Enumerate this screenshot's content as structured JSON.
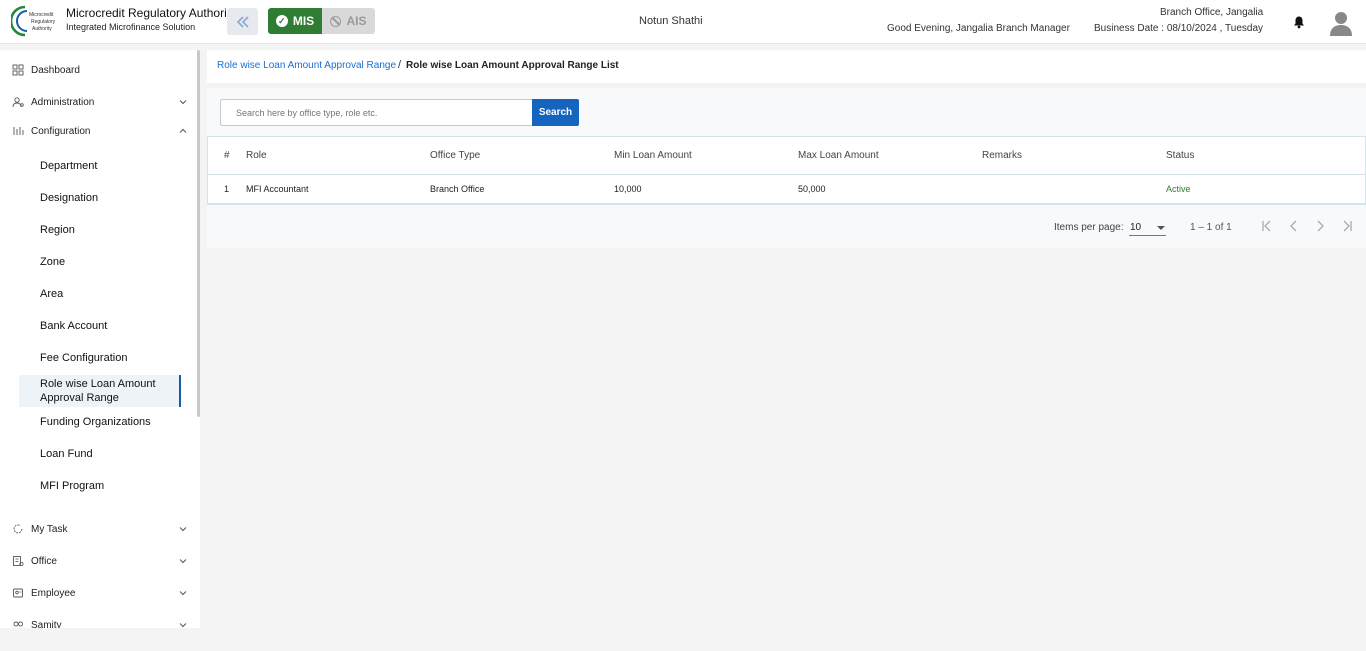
{
  "header": {
    "org_name": "Microcredit Regulatory Authority",
    "org_subtitle": "Integrated Microfinance Solution",
    "logo_text": [
      "Microcredit",
      "Regulatory",
      "Authority"
    ],
    "mis_label": "MIS",
    "ais_label": "AIS",
    "app_title": "Notun Shathi",
    "greeting": "Good Evening, Jangalia Branch Manager",
    "branch": "Branch Office, Jangalia",
    "business_date": "Business Date : 08/10/2024 , Tuesday",
    "colors": {
      "mis": "#2e7d32",
      "accent": "#1565c0"
    }
  },
  "sidebar": {
    "items": [
      {
        "label": "Dashboard",
        "icon": "grid-icon"
      },
      {
        "label": "Administration",
        "icon": "users-gear-icon"
      },
      {
        "label": "Configuration",
        "icon": "sort-icon"
      }
    ],
    "config_sub": [
      "Department",
      "Designation",
      "Region",
      "Zone",
      "Area",
      "Bank Account",
      "Fee Configuration",
      "Role wise Loan Amount Approval Range",
      "Funding Organizations",
      "Loan Fund",
      "MFI Program"
    ],
    "lower_items": [
      {
        "label": "My Task",
        "icon": "refresh-icon"
      },
      {
        "label": "Office",
        "icon": "office-icon"
      },
      {
        "label": "Employee",
        "icon": "employee-icon"
      },
      {
        "label": "Samity",
        "icon": "samity-icon"
      }
    ]
  },
  "breadcrumb": {
    "link": "Role wise Loan Amount Approval Range",
    "separator": "/",
    "current": "Role wise Loan Amount Approval Range List"
  },
  "search": {
    "placeholder": "Search here by office type, role etc.",
    "button": "Search"
  },
  "table": {
    "columns": [
      "#",
      "Role",
      "Office Type",
      "Min Loan Amount",
      "Max Loan Amount",
      "Remarks",
      "Status"
    ],
    "rows": [
      [
        "1",
        "MFI Accountant",
        "Branch Office",
        "10,000",
        "50,000",
        "",
        "Active"
      ]
    ]
  },
  "pagination": {
    "items_per_page_label": "Items per page:",
    "items_per_page": "10",
    "range": "1 – 1 of 1"
  }
}
